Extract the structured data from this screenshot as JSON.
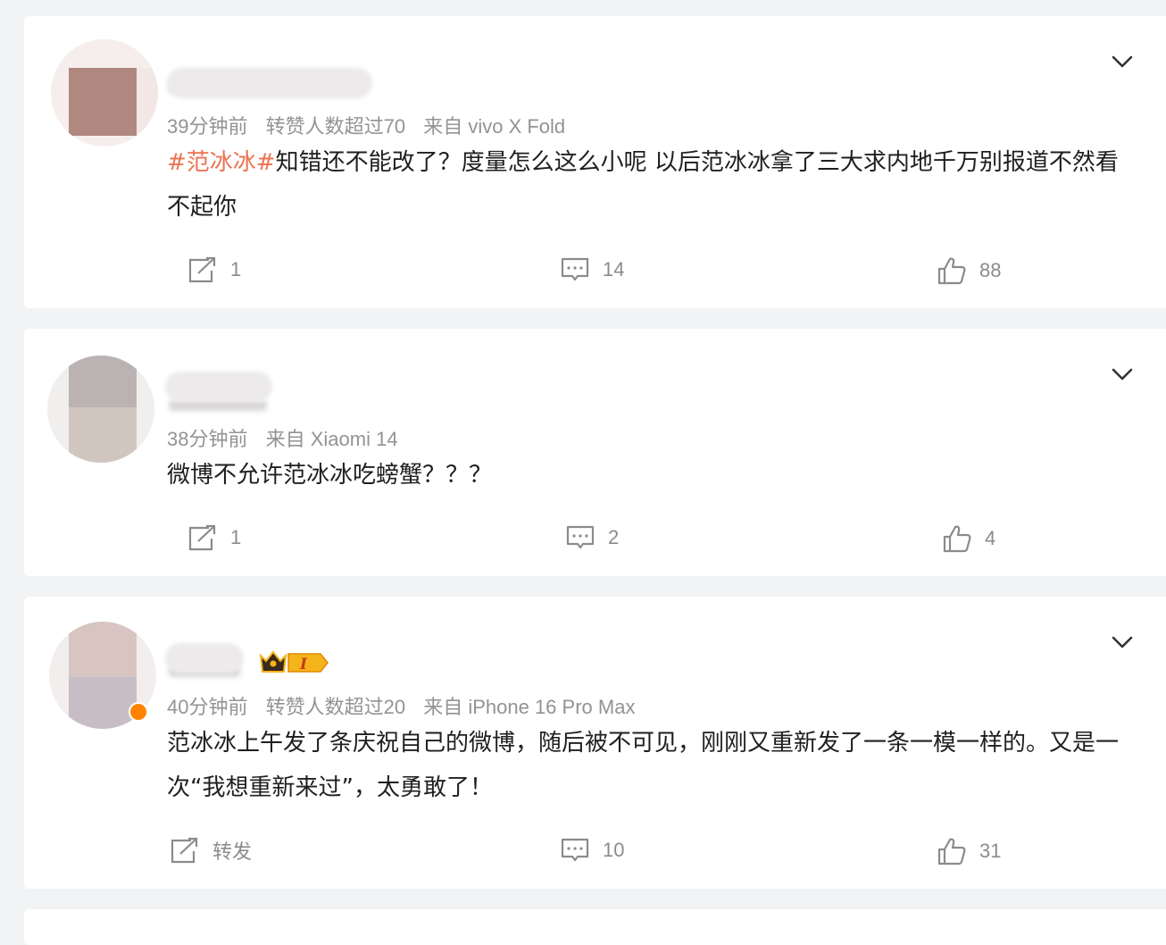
{
  "posts": [
    {
      "meta": {
        "time": "39分钟前",
        "reposts_note": "转赞人数超过70",
        "source": "来自 vivo X Fold"
      },
      "text": {
        "topic": "#范冰冰#",
        "body": "知错还不能改了？度量怎么这么小呢 以后范冰冰拿了三大求内地千万别报道不然看不起你"
      },
      "actions": {
        "repost": "1",
        "comment": "14",
        "like": "88"
      }
    },
    {
      "meta": {
        "time": "38分钟前",
        "source": "来自 Xiaomi 14"
      },
      "text": {
        "body": "微博不允许范冰冰吃螃蟹？？？"
      },
      "actions": {
        "repost": "1",
        "comment": "2",
        "like": "4"
      }
    },
    {
      "meta": {
        "time": "40分钟前",
        "reposts_note": "转赞人数超过20",
        "source": "来自 iPhone 16 Pro Max"
      },
      "text": {
        "body": "范冰冰上午发了条庆祝自己的微博，随后被不可见，刚刚又重新发了一条一模一样的。又是一次“我想重新来过”，太勇敢了！"
      },
      "actions": {
        "repost": "转发",
        "comment": "10",
        "like": "31"
      }
    }
  ],
  "icons": {
    "more": "chevron-down-icon",
    "repost": "repost-icon",
    "comment": "comment-icon",
    "like": "thumbs-up-icon",
    "vip": "vip-crown-badge"
  },
  "colors": {
    "topic": "#eb7350",
    "meta": "#939393",
    "action": "#8b8b8b",
    "vip_orange": "#ff8200"
  }
}
